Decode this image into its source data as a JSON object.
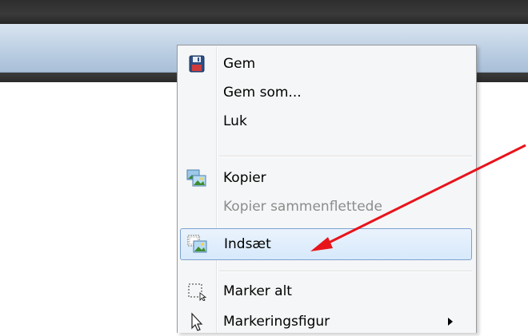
{
  "context_menu": {
    "items": [
      {
        "label": "Gem",
        "icon": "floppy-disk-icon",
        "enabled": true
      },
      {
        "label": "Gem som...",
        "icon": null,
        "enabled": true
      },
      {
        "label": "Luk",
        "icon": null,
        "enabled": true
      },
      {
        "label": "Kopier",
        "icon": "copy-image-icon",
        "enabled": true
      },
      {
        "label": "Kopier sammenflettede",
        "icon": null,
        "enabled": false
      },
      {
        "label": "Indsæt",
        "icon": "paste-image-icon",
        "enabled": true,
        "highlighted": true
      },
      {
        "label": "Marker alt",
        "icon": "select-all-icon",
        "enabled": true
      },
      {
        "label": "Markeringsfigur",
        "icon": "pointer-icon",
        "enabled": true,
        "has_submenu": true
      }
    ]
  },
  "colors": {
    "highlight_border": "#7da2ce",
    "annotation_arrow": "#e8141b",
    "disabled_text": "#8c8c8c"
  }
}
